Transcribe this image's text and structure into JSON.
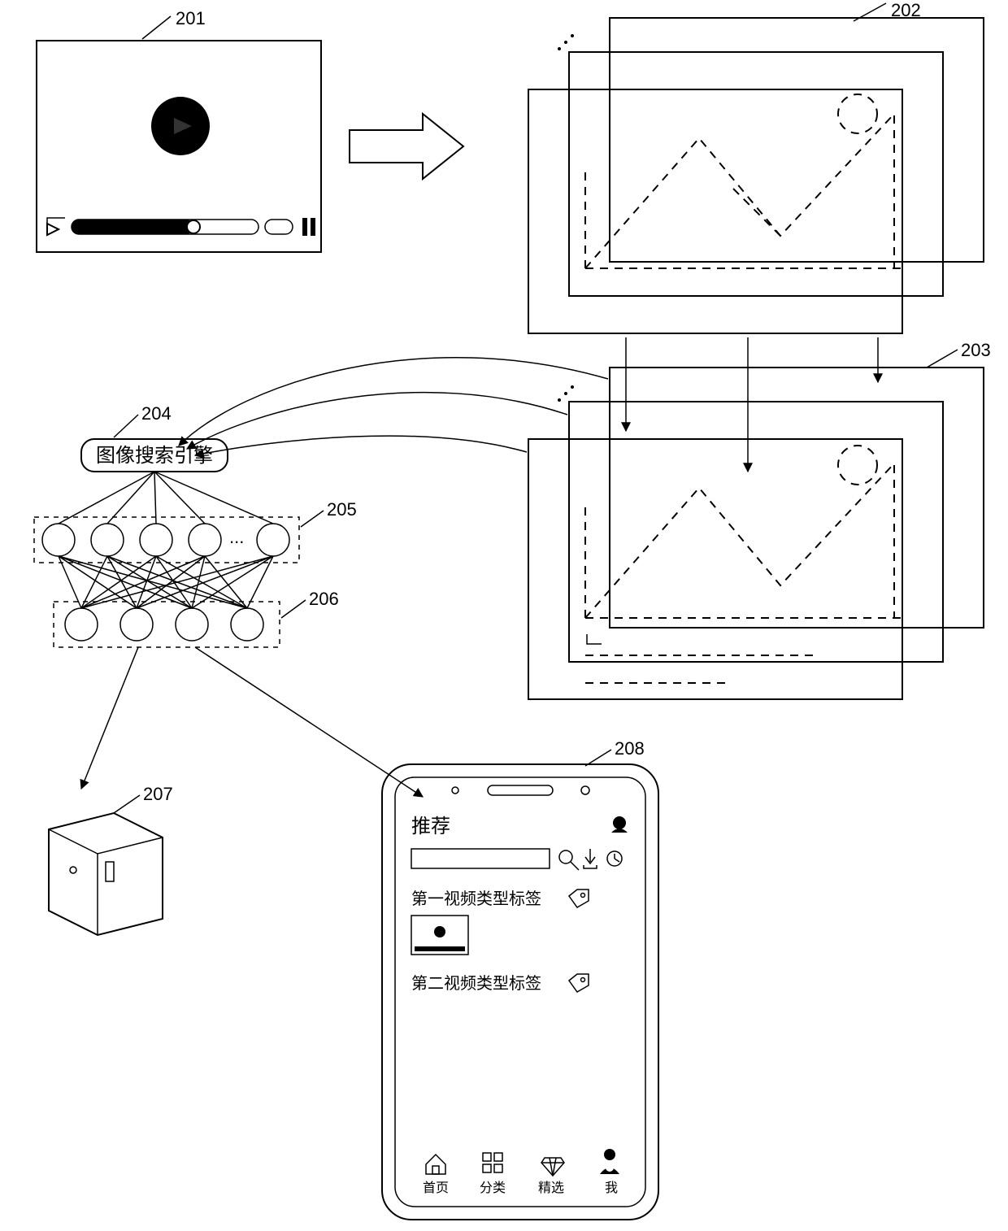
{
  "refs": {
    "r201": "201",
    "r202": "202",
    "r203": "203",
    "r204": "204",
    "r205": "205",
    "r206": "206",
    "r207": "207",
    "r208": "208"
  },
  "searchEngineLabel": "图像搜索引擎",
  "phone": {
    "header": "推荐",
    "label1": "第一视频类型标签",
    "label2": "第二视频类型标签",
    "nav": {
      "home": "首页",
      "category": "分类",
      "featured": "精选",
      "me": "我"
    }
  }
}
